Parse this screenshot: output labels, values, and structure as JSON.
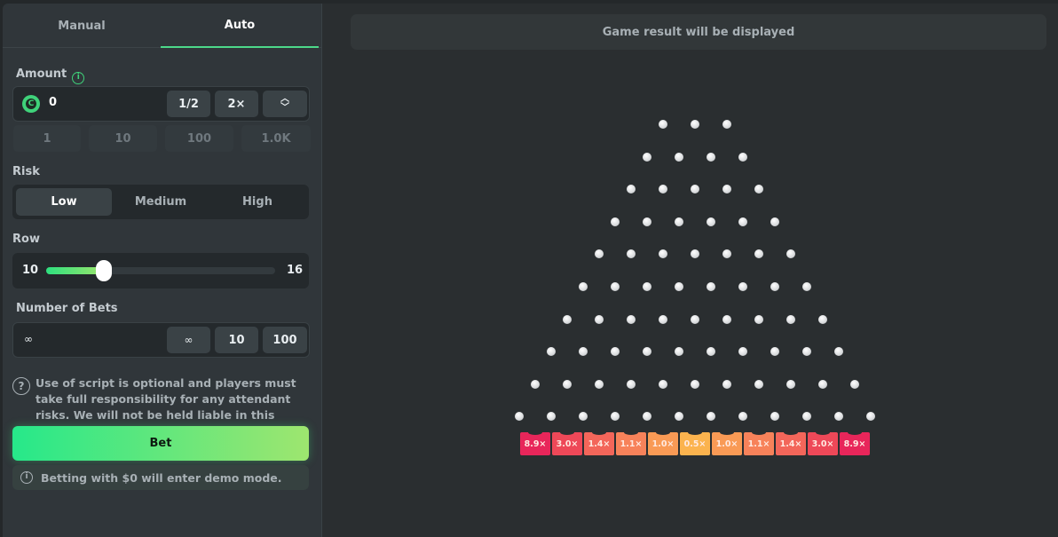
{
  "tabs": [
    {
      "label": "Manual",
      "active": false
    },
    {
      "label": "Auto",
      "active": true
    }
  ],
  "amount": {
    "label": "Amount",
    "value": "0",
    "half_label": "1/2",
    "double_label": "2×",
    "quick_values": [
      "1",
      "10",
      "100",
      "1.0K"
    ]
  },
  "risk": {
    "label": "Risk",
    "options": [
      "Low",
      "Medium",
      "High"
    ],
    "selected": "Low"
  },
  "row": {
    "label": "Row",
    "min": "10",
    "max": "16",
    "value": 10,
    "fill_fraction": 0.25
  },
  "bets": {
    "label": "Number of Bets",
    "value": "∞",
    "options": [
      "∞",
      "10",
      "100"
    ]
  },
  "notice": "Use of script is optional and players must take full responsibility for any attendant risks. We will not be held liable in this regard.",
  "bet_button": "Bet",
  "demo_notice": "Betting with $0 will enter demo mode.",
  "game": {
    "result_text": "Game result will be displayed",
    "rows": 10,
    "multipliers": [
      "8.9×",
      "3.0×",
      "1.4×",
      "1.1×",
      "1.0×",
      "0.5×",
      "1.0×",
      "1.1×",
      "1.4×",
      "3.0×",
      "8.9×"
    ],
    "bucket_colors": [
      "#e8265a",
      "#ee4858",
      "#f3665a",
      "#f7825a",
      "#f99a55",
      "#fbb34e",
      "#f99a55",
      "#f7825a",
      "#f3665a",
      "#ee4858",
      "#e8265a"
    ]
  }
}
